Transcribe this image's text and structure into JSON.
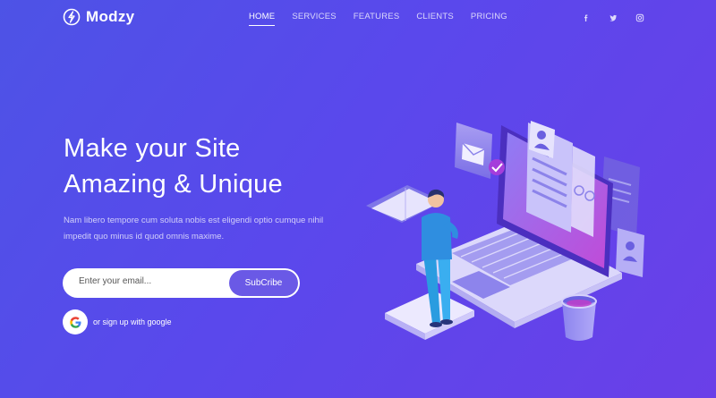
{
  "brand": {
    "name": "Modzy"
  },
  "nav": {
    "items": [
      {
        "label": "HOME",
        "active": true
      },
      {
        "label": "SERVICES",
        "active": false
      },
      {
        "label": "FEATURES",
        "active": false
      },
      {
        "label": "CLIENTS",
        "active": false
      },
      {
        "label": "PRICING",
        "active": false
      }
    ]
  },
  "social": [
    "facebook-icon",
    "twitter-icon",
    "instagram-icon"
  ],
  "hero": {
    "title_line1": "Make your Site",
    "title_line2": "Amazing & Unique",
    "description": "Nam libero tempore cum soluta nobis est eligendi optio cumque nihil impedit quo minus id quod omnis maxime."
  },
  "subscribe": {
    "placeholder": "Enter your email...",
    "button_label": "SubCribe"
  },
  "google": {
    "label": "or sign up with google"
  },
  "colors": {
    "accent": "#6a59e6",
    "background": "#5a48ec"
  }
}
